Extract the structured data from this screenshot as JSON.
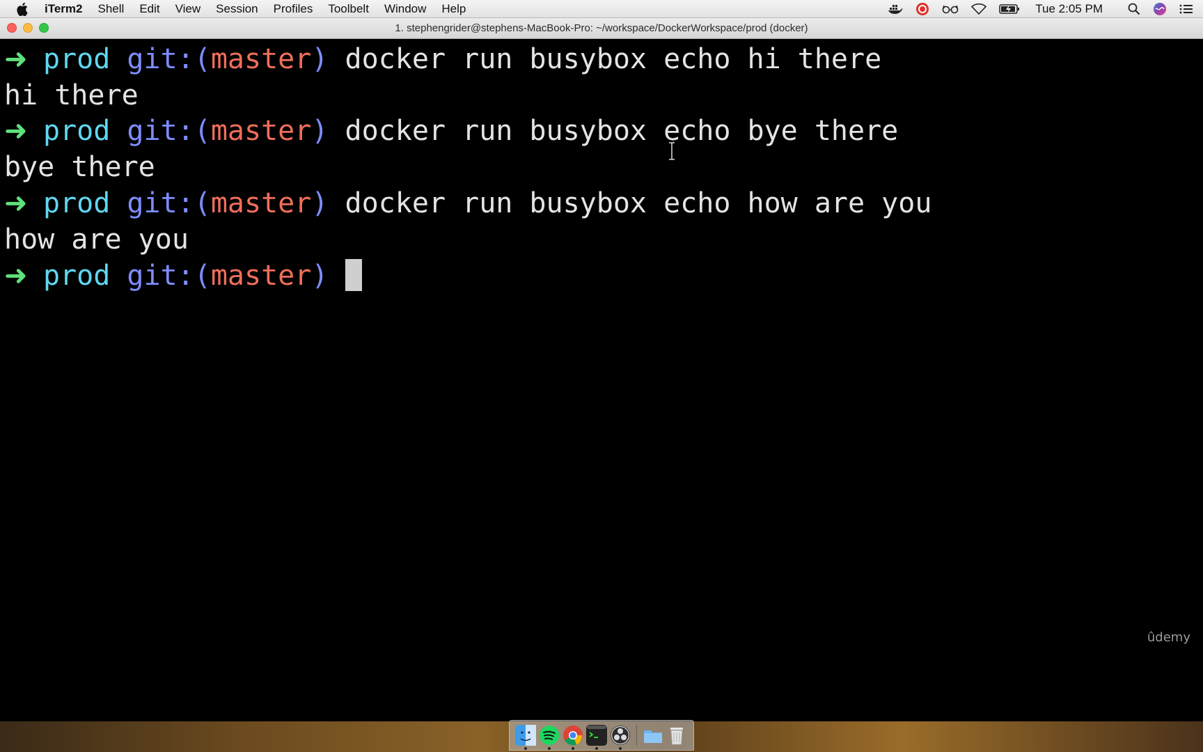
{
  "menubar": {
    "app_name": "iTerm2",
    "items": [
      "Shell",
      "Edit",
      "View",
      "Session",
      "Profiles",
      "Toolbelt",
      "Window",
      "Help"
    ],
    "clock": "Tue 2:05 PM"
  },
  "window": {
    "title": "1. stephengrider@stephens-MacBook-Pro: ~/workspace/DockerWorkspace/prod (docker)"
  },
  "terminal": {
    "prompt": {
      "arrow": "➜",
      "dir": "prod",
      "git_prefix": "git:(",
      "branch": "master",
      "git_suffix": ")"
    },
    "lines": [
      {
        "type": "prompt",
        "command": "docker run busybox echo hi there"
      },
      {
        "type": "output",
        "text": "hi there"
      },
      {
        "type": "prompt",
        "command": "docker run busybox echo bye there"
      },
      {
        "type": "output",
        "text": "bye there"
      },
      {
        "type": "prompt",
        "command": "docker run busybox echo how are you"
      },
      {
        "type": "output",
        "text": "how are you"
      },
      {
        "type": "prompt",
        "command": ""
      }
    ]
  },
  "watermark": "ûdemy",
  "dock": {
    "apps": [
      "finder-icon",
      "spotify-icon",
      "chrome-icon",
      "terminal-icon",
      "obs-icon"
    ],
    "others": [
      "downloads-folder-icon",
      "trash-icon"
    ]
  },
  "colors": {
    "prompt_arrow": "#5fe07a",
    "dir": "#5fd7f0",
    "git": "#7f8cff",
    "branch": "#ef6e5b",
    "text": "#e4e4e4"
  }
}
